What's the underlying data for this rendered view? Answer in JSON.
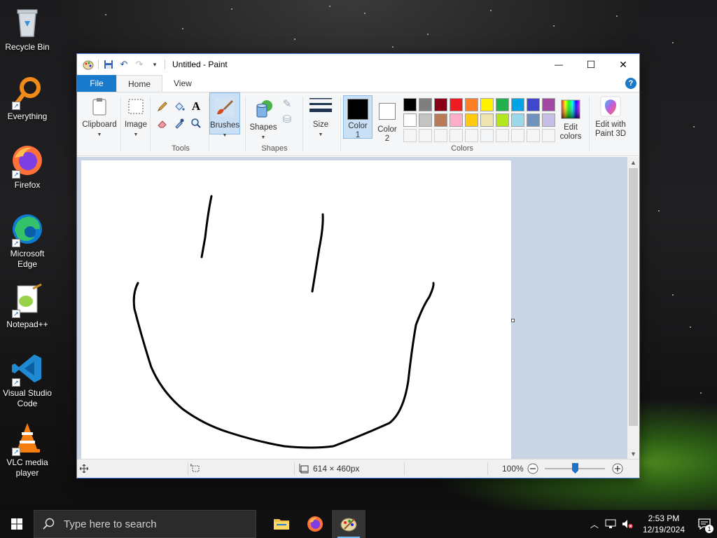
{
  "desktop": {
    "icons": [
      {
        "label": "Recycle Bin",
        "icon": "recycle-bin-icon"
      },
      {
        "label": "Everything",
        "icon": "everything-search-icon"
      },
      {
        "label": "Firefox",
        "icon": "firefox-icon"
      },
      {
        "label": "Microsoft Edge",
        "icon": "edge-icon"
      },
      {
        "label": "Notepad++",
        "icon": "notepad-plus-plus-icon"
      },
      {
        "label": "Visual Studio Code",
        "icon": "vscode-icon"
      },
      {
        "label": "VLC media player",
        "icon": "vlc-icon"
      }
    ]
  },
  "window": {
    "title": "Untitled - Paint",
    "controls": {
      "minimize": "—",
      "maximize": "☐",
      "close": "✕"
    }
  },
  "tabs": {
    "file": "File",
    "home": "Home",
    "view": "View",
    "help": "?"
  },
  "ribbon": {
    "clipboard": "Clipboard",
    "image": "Image",
    "tools_group": "Tools",
    "brushes": "Brushes",
    "shapes": "Shapes",
    "shapes_group": "Shapes",
    "size": "Size",
    "color1": "Color 1",
    "color2": "Color 2",
    "edit_colors": "Edit colors",
    "colors_group": "Colors",
    "edit_paint3d": "Edit with Paint 3D",
    "palette_row1": [
      "#000000",
      "#7f7f7f",
      "#880015",
      "#ed1c24",
      "#ff7f27",
      "#fff200",
      "#22b14c",
      "#00a2e8",
      "#3f48cc",
      "#a349a4"
    ],
    "palette_row2": [
      "#ffffff",
      "#c3c3c3",
      "#b97a57",
      "#ffaec9",
      "#ffc90e",
      "#efe4b0",
      "#b5e61d",
      "#99d9ea",
      "#7092be",
      "#c8bfe7"
    ],
    "color1_value": "#000000",
    "color2_value": "#ffffff"
  },
  "statusbar": {
    "dimensions": "614 × 460px",
    "zoom": "100%"
  },
  "taskbar": {
    "search_placeholder": "Type here to search",
    "time": "2:53 PM",
    "date": "12/19/2024",
    "notification_count": "1"
  }
}
